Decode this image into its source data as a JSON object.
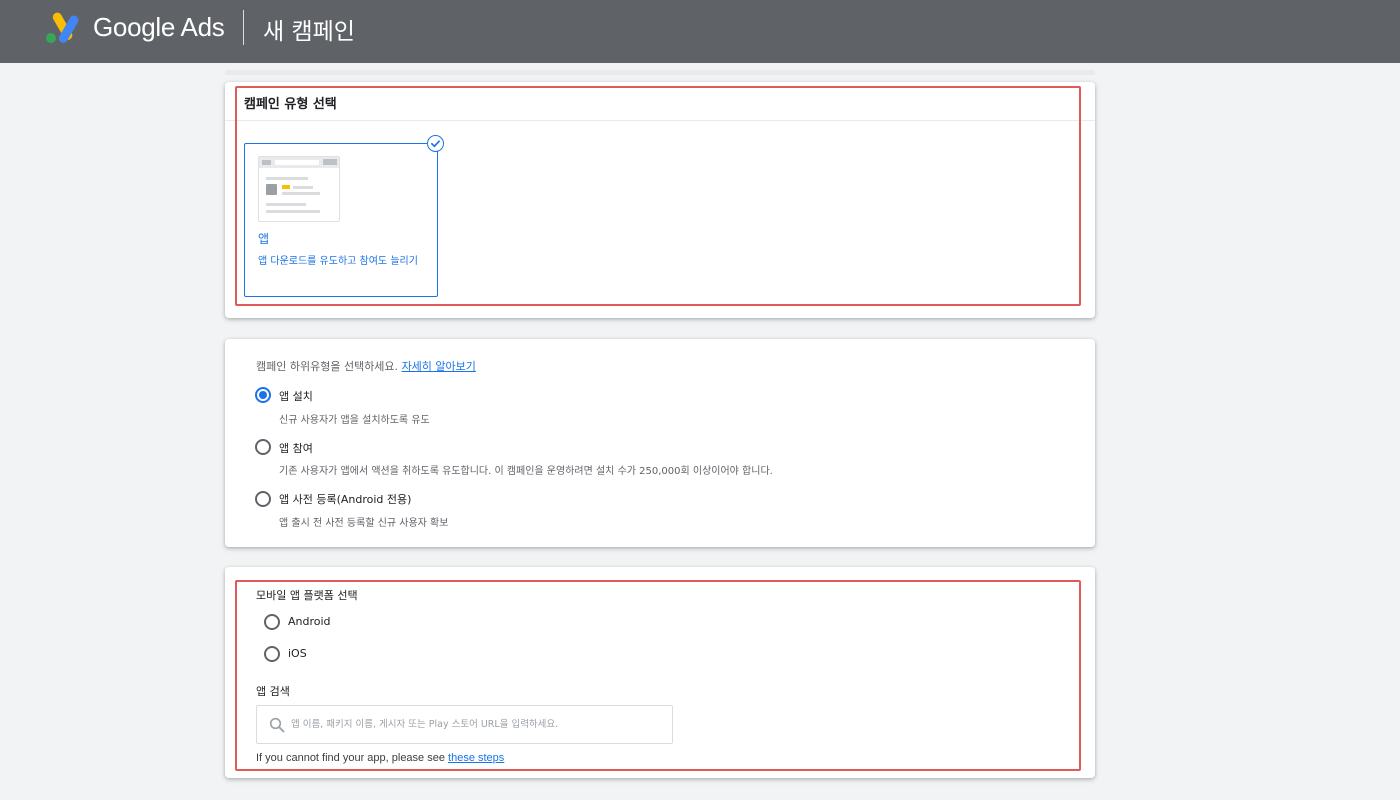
{
  "header": {
    "brand": "Google Ads",
    "page_title": "새 캠페인",
    "colors": {
      "bar": "#5f6368",
      "logo_blue": "#4285f4",
      "logo_yellow": "#fbbc04",
      "logo_green": "#34a853"
    }
  },
  "campaign_type": {
    "title": "캠페인 유형 선택",
    "selected_tile": {
      "title": "앱",
      "description": "앱 다운로드를 유도하고 참여도 늘리기",
      "icon": "app-preview-illustration",
      "selected": true
    }
  },
  "subtype": {
    "prompt": "캠페인 하위유형을 선택하세요.",
    "learn_more": "자세히 알아보기",
    "options": [
      {
        "label": "앱 설치",
        "description": "신규 사용자가 앱을 설치하도록 유도",
        "checked": true
      },
      {
        "label": "앱 참여",
        "description": "기존 사용자가 앱에서 액션을 취하도록 유도합니다. 이 캠페인을 운영하려면 설치 수가 250,000회 이상이어야 합니다.",
        "checked": false
      },
      {
        "label": "앱 사전 등록(Android 전용)",
        "description": "앱 출시 전 사전 등록할 신규 사용자 확보",
        "checked": false
      }
    ]
  },
  "platform": {
    "title": "모바일 앱 플랫폼 선택",
    "options": [
      {
        "label": "Android",
        "checked": false
      },
      {
        "label": "iOS",
        "checked": false
      }
    ],
    "search_label": "앱 검색",
    "search_placeholder": "앱 이름, 패키지 이름, 게시자 또는 Play 스토어 URL을 입력하세요.",
    "search_value": "",
    "help_prefix": "If you cannot find your app, please see ",
    "help_link": "these steps"
  },
  "accent_colors": {
    "primary": "#1a73e8",
    "highlight": "#e05a5a"
  }
}
